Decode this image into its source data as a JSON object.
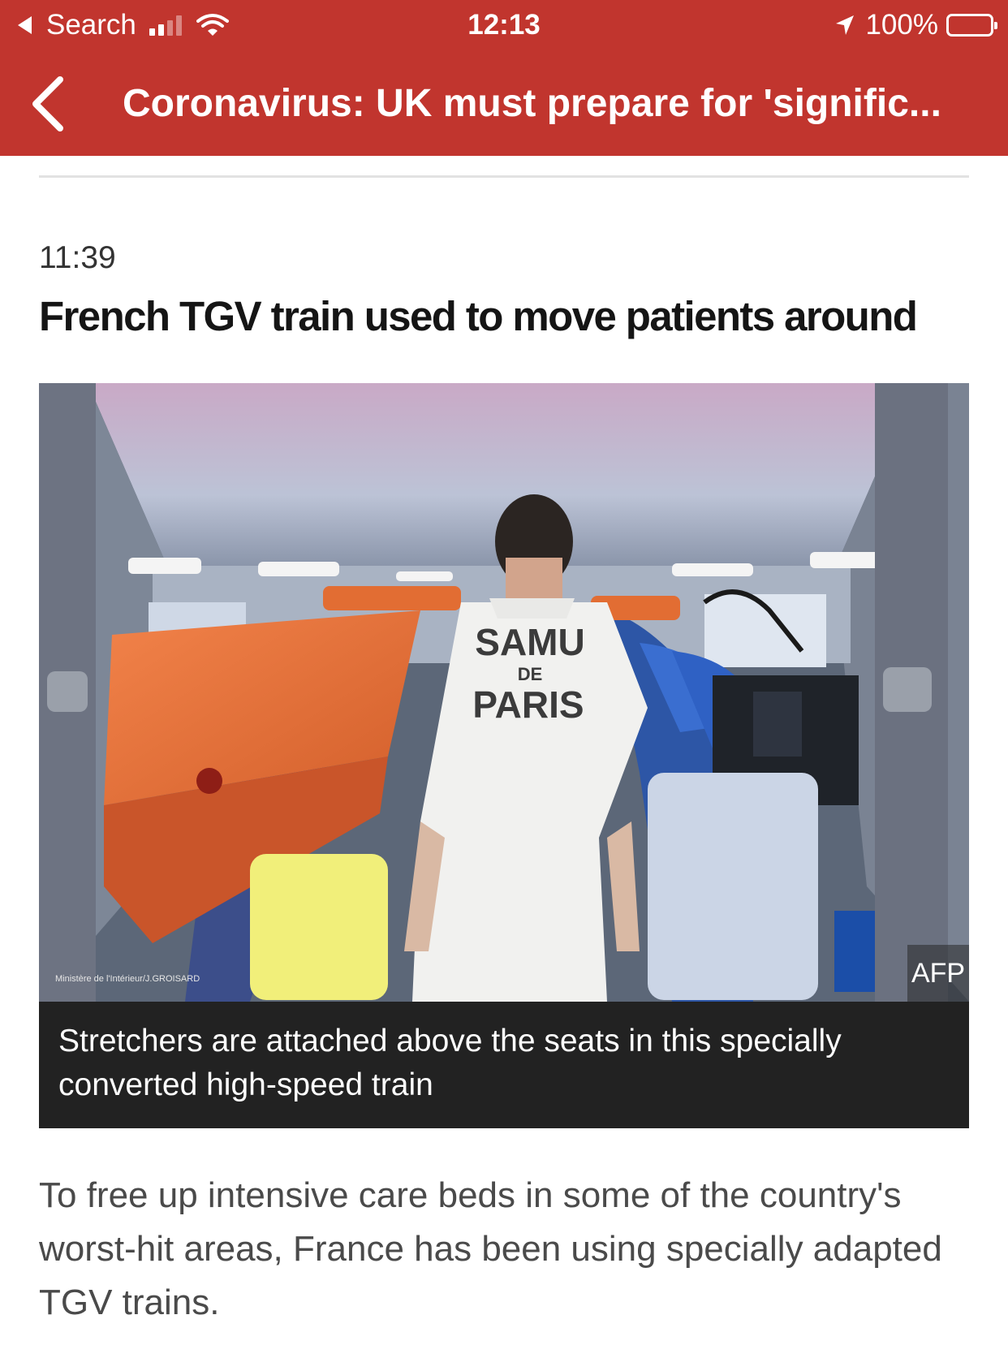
{
  "status_bar": {
    "back_app": "Search",
    "time": "12:13",
    "battery": "100%",
    "battery_level": 1.0,
    "signal_bars": 2
  },
  "nav": {
    "title": "Coronavirus: UK must prepare for 'signific..."
  },
  "post": {
    "timestamp": "11:39",
    "headline": "French TGV train used to move patients around",
    "image": {
      "credit": "Ministère de l'Intérieur/J.GROISARD",
      "agency": "AFP",
      "shirt_text": [
        "SAMU",
        "DE",
        "PARIS"
      ],
      "caption": "Stretchers are attached above the seats in this specially converted high-speed train"
    },
    "body": "To free up intensive care beds in some of the country's worst-hit areas, France has been using specially adapted TGV trains."
  },
  "colors": {
    "brand_red": "#c1352e",
    "caption_bg": "#222222"
  }
}
